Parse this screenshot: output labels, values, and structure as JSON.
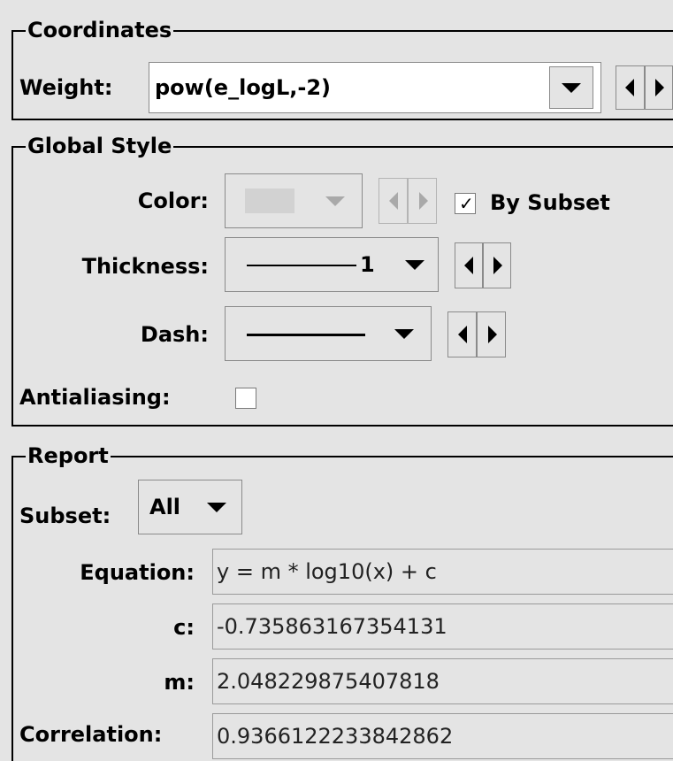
{
  "coordinates": {
    "title": "Coordinates",
    "weight_label": "Weight:",
    "weight_value": "pow(e_logL,-2)"
  },
  "global_style": {
    "title": "Global Style",
    "color_label": "Color:",
    "by_subset_label": "By Subset",
    "by_subset_checked": true,
    "thickness_label": "Thickness:",
    "thickness_value": "1",
    "dash_label": "Dash:",
    "antialiasing_label": "Antialiasing:",
    "antialiasing_checked": false
  },
  "report": {
    "title": "Report",
    "subset_label": "Subset:",
    "subset_value": "All",
    "equation_label": "Equation:",
    "equation_value": "y = m * log10(x) + c",
    "c_label": "c:",
    "c_value": "-0.735863167354131",
    "m_label": "m:",
    "m_value": "2.048229875407818",
    "correlation_label": "Correlation:",
    "correlation_value": "0.9366122233842862"
  }
}
